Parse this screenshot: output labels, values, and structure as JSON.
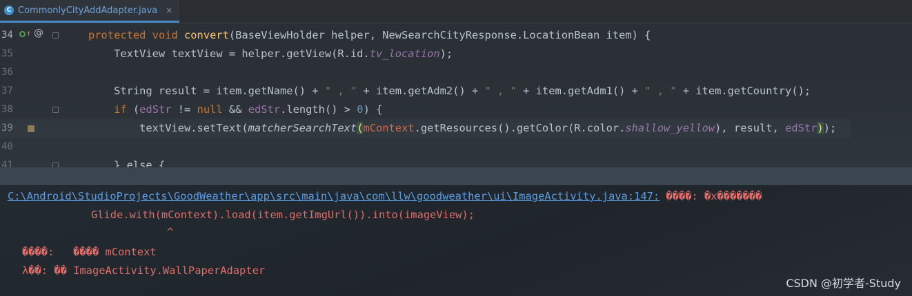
{
  "tab": {
    "icon_letter": "C",
    "label": "CommonlyCityAddAdapter.java",
    "close": "×"
  },
  "gutter": {
    "line_numbers": [
      "34",
      "35",
      "36",
      "37",
      "38",
      "39",
      "40",
      "41"
    ],
    "annotation_symbol": "@"
  },
  "code": {
    "l34": {
      "k1": "protected ",
      "k2": "void ",
      "fn": "convert",
      "rest": "(BaseViewHolder helper, NewSearchCityResponse.LocationBean item) {"
    },
    "l35": {
      "a": "    TextView textView = helper.getView(R.id.",
      "f": "tv_location",
      "b": ");"
    },
    "l37": {
      "a": "    String result = item.getName() + ",
      "s1": "\" , \"",
      "b": " + item.getAdm2() + ",
      "s2": "\" , \"",
      "c": " + item.getAdm1() + ",
      "s3": "\" , \"",
      "d": " + item.getCountry();"
    },
    "l38": {
      "k": "    if ",
      "a": "(",
      "f1": "edStr",
      "b": " != ",
      "k2": "null",
      "c": " && ",
      "f2": "edStr",
      "d": ".length() > ",
      "n": "0",
      "e": ") {"
    },
    "l39": {
      "a": "        textView.setText(",
      "it": "matcherSearchText",
      "p1": "(",
      "ctx": "mContext",
      "b": ".getResources().getColor(R.color.",
      "f": "shallow_yellow",
      "c": "), result, ",
      "f2": "edStr",
      "p2": ")",
      "d": ");"
    },
    "l41": {
      "a": "    } else {"
    }
  },
  "console": {
    "link": "C:\\Android\\StudioProjects\\GoodWeather\\app\\src\\main\\java\\com\\llw\\goodweather\\ui\\ImageActivity.java:147:",
    "err1": " ����: �x�������",
    "src": "Glide.with(mContext).load(item.getImgUrl()).into(imageView);",
    "caret": "^",
    "sym_label": "����:   ",
    "sym_value": "���� mContext",
    "loc_label": "λ��: ",
    "loc_value": "�� ImageActivity.WallPaperAdapter"
  },
  "watermark": "CSDN @初学者-Study"
}
